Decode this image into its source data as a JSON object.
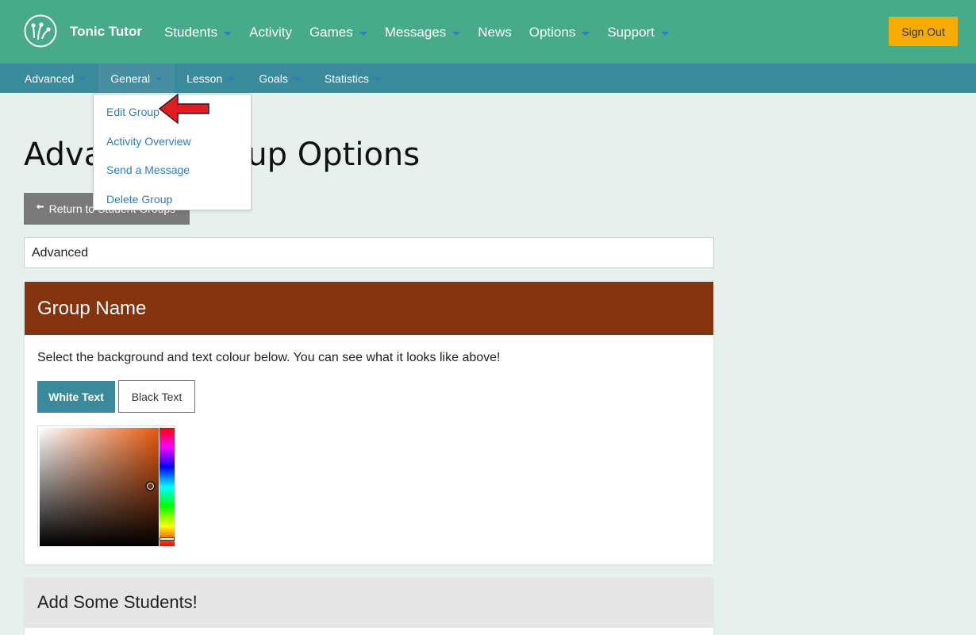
{
  "brand": {
    "name": "Tonic Tutor"
  },
  "topnav": [
    {
      "label": "Students",
      "has_caret": true
    },
    {
      "label": "Activity",
      "has_caret": false
    },
    {
      "label": "Games",
      "has_caret": true
    },
    {
      "label": "Messages",
      "has_caret": true
    },
    {
      "label": "News",
      "has_caret": false
    },
    {
      "label": "Options",
      "has_caret": true
    },
    {
      "label": "Support",
      "has_caret": true
    }
  ],
  "signout_label": "Sign Out",
  "subnav": [
    {
      "label": "Advanced",
      "active": false
    },
    {
      "label": "General",
      "active": true
    },
    {
      "label": "Lesson",
      "active": false
    },
    {
      "label": "Goals",
      "active": false
    },
    {
      "label": "Statistics",
      "active": false
    }
  ],
  "dropdown": [
    {
      "label": "Edit Group"
    },
    {
      "label": "Activity Overview"
    },
    {
      "label": "Send a Message"
    },
    {
      "label": "Delete Group"
    }
  ],
  "page": {
    "title": "Advanced Group Options",
    "return_label": "Return to Student Groups",
    "group_name_value": "Advanced"
  },
  "group_panel": {
    "title": "Group Name",
    "description": "Select the background and text colour below. You can see what it looks like above!",
    "white_text_label": "White Text",
    "black_text_label": "Black Text",
    "header_color": "#83330d",
    "picker_hue_color": "#e85a10"
  },
  "students_panel": {
    "title": "Add Some Students!"
  },
  "colors": {
    "topbar": "#47aa88",
    "subbar": "#3b8a9c",
    "signout": "#f7aa00",
    "accent_link": "#2a7fc0"
  }
}
